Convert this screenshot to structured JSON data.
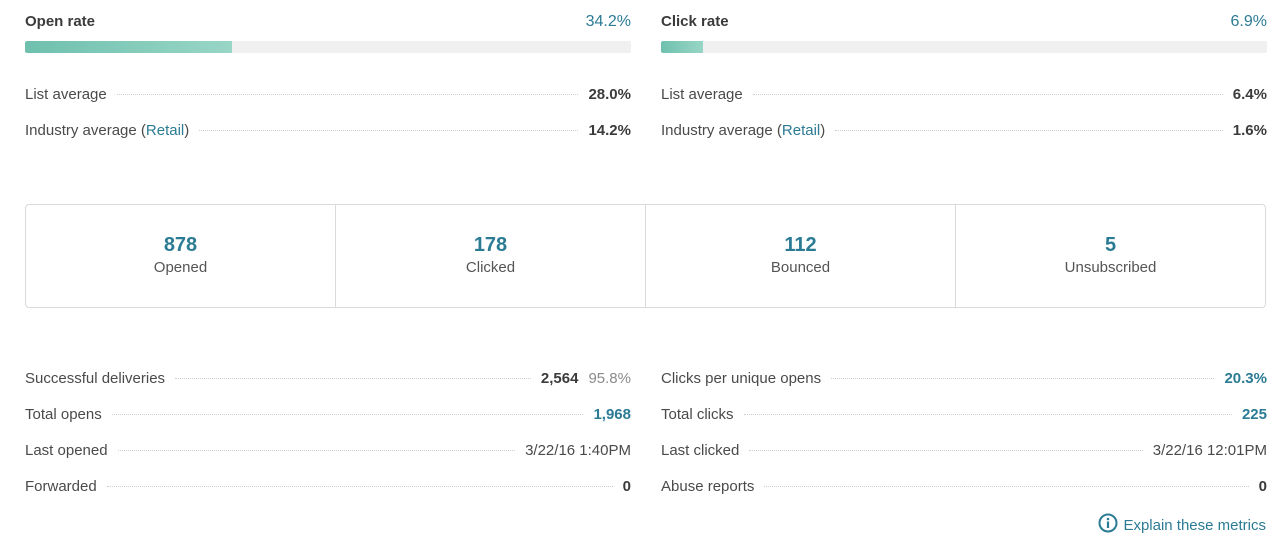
{
  "open_rate": {
    "title": "Open rate",
    "value": "34.2%",
    "progress_percent": 34.2,
    "list_average_label": "List average",
    "list_average_value": "28.0%",
    "industry_label_prefix": "Industry average (",
    "industry_link": "Retail",
    "industry_label_suffix": ")",
    "industry_value": "14.2%"
  },
  "click_rate": {
    "title": "Click rate",
    "value": "6.9%",
    "progress_percent": 6.9,
    "list_average_label": "List average",
    "list_average_value": "6.4%",
    "industry_label_prefix": "Industry average (",
    "industry_link": "Retail",
    "industry_label_suffix": ")",
    "industry_value": "1.6%"
  },
  "stats": [
    {
      "number": "878",
      "label": "Opened"
    },
    {
      "number": "178",
      "label": "Clicked"
    },
    {
      "number": "112",
      "label": "Bounced"
    },
    {
      "number": "5",
      "label": "Unsubscribed"
    }
  ],
  "details_left": [
    {
      "label": "Successful deliveries",
      "value": "2,564",
      "sub": "95.8%"
    },
    {
      "label": "Total opens",
      "value": "1,968"
    },
    {
      "label": "Last opened",
      "value": "3/22/16 1:40PM"
    },
    {
      "label": "Forwarded",
      "value": "0"
    }
  ],
  "details_right": [
    {
      "label": "Clicks per unique opens",
      "value": "20.3%"
    },
    {
      "label": "Total clicks",
      "value": "225"
    },
    {
      "label": "Last clicked",
      "value": "3/22/16 12:01PM"
    },
    {
      "label": "Abuse reports",
      "value": "0"
    }
  ],
  "explain_link": {
    "icon": "info-icon",
    "label": "Explain these metrics"
  },
  "colors": {
    "accent": "#2b7b94",
    "bar_start": "#6fc0ae",
    "bar_end": "#98d6c6",
    "track": "#f0f0f0"
  }
}
